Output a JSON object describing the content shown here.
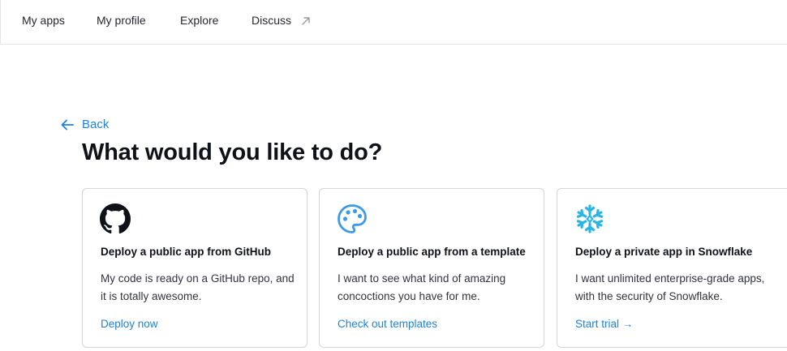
{
  "nav": {
    "items": [
      {
        "label": "My apps"
      },
      {
        "label": "My profile"
      },
      {
        "label": "Explore"
      },
      {
        "label": "Discuss"
      }
    ]
  },
  "back": {
    "label": "Back"
  },
  "page": {
    "title": "What would you like to do?"
  },
  "cards": [
    {
      "icon": "github-icon",
      "title": "Deploy a public app from GitHub",
      "description": "My code is ready on a GitHub repo, and it is totally awesome.",
      "link": "Deploy now"
    },
    {
      "icon": "palette-icon",
      "title": "Deploy a public app from a template",
      "description": "I want to see what kind of amazing concoctions you have for me.",
      "link": "Check out templates"
    },
    {
      "icon": "snowflake-icon",
      "title": "Deploy a private app in Snowflake",
      "description": "I want unlimited enterprise-grade apps, with the security of Snowflake.",
      "link": "Start trial →"
    }
  ],
  "colors": {
    "link": "#1c83e1",
    "text": "#262730",
    "heading": "#0e1117",
    "border": "#d5d5d9",
    "palette": "#3b9be8",
    "snowflake": "#29b5e8"
  }
}
